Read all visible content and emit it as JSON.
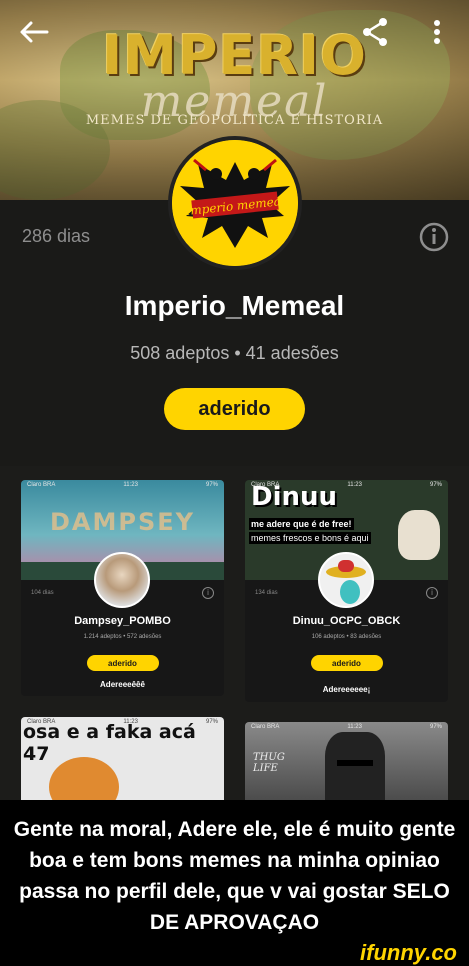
{
  "banner": {
    "title": "IMPERIO",
    "subtitle": "memeal",
    "tagline": "MEMES DE GEOPOLÍTICA E HISTORIA"
  },
  "topbar": {
    "back_icon": "arrow-left-icon",
    "share_icon": "share-icon",
    "more_icon": "more-vertical-icon"
  },
  "profile": {
    "days": "286 dias",
    "avatar_text": "Imperio memeal",
    "name": "Imperio_Memeal",
    "stats": "508 adeptos  •  41 adesões",
    "joined_label": "aderido",
    "info_icon": "info-icon"
  },
  "cards": [
    {
      "status_left": "Claro BRA",
      "status_time": "11:23",
      "status_right": "97%",
      "banner_text": "DAMPSEY",
      "days": "104 dias",
      "name": "Dampsey_POMBO",
      "stats": "1.214 adeptos  •  572 adesões",
      "button": "aderido",
      "caption": "Adereeeêêê"
    },
    {
      "status_left": "Claro BRA",
      "status_time": "11:23",
      "status_right": "97%",
      "banner_title": "Dinuu",
      "banner_line1": "me adere que é de free!",
      "banner_line2": "memes frescos e bons é aqui",
      "days": "134 dias",
      "name": "Dinuu_OCPC_OBCK",
      "stats": "106 adeptos  •  83 adesões",
      "button": "aderido",
      "caption": "Adereeeeee¡"
    },
    {
      "status_left": "Claro BRA",
      "status_time": "11:23",
      "status_right": "97%",
      "banner_text": "osa e a faka acá 47"
    },
    {
      "status_left": "Claro BRA",
      "status_time": "11:23",
      "status_right": "97%",
      "banner_text": "THUG LIFE"
    }
  ],
  "caption": "Gente na moral, Adere ele, ele é muito gente boa e tem bons memes na minha opiniao passa no perfil dele, que v  vai gostar SELO DE APROVAÇAO",
  "brand": "ifunny.co",
  "colors": {
    "accent": "#ffd400",
    "background": "#1a1a18",
    "caption_bg": "#000000"
  }
}
